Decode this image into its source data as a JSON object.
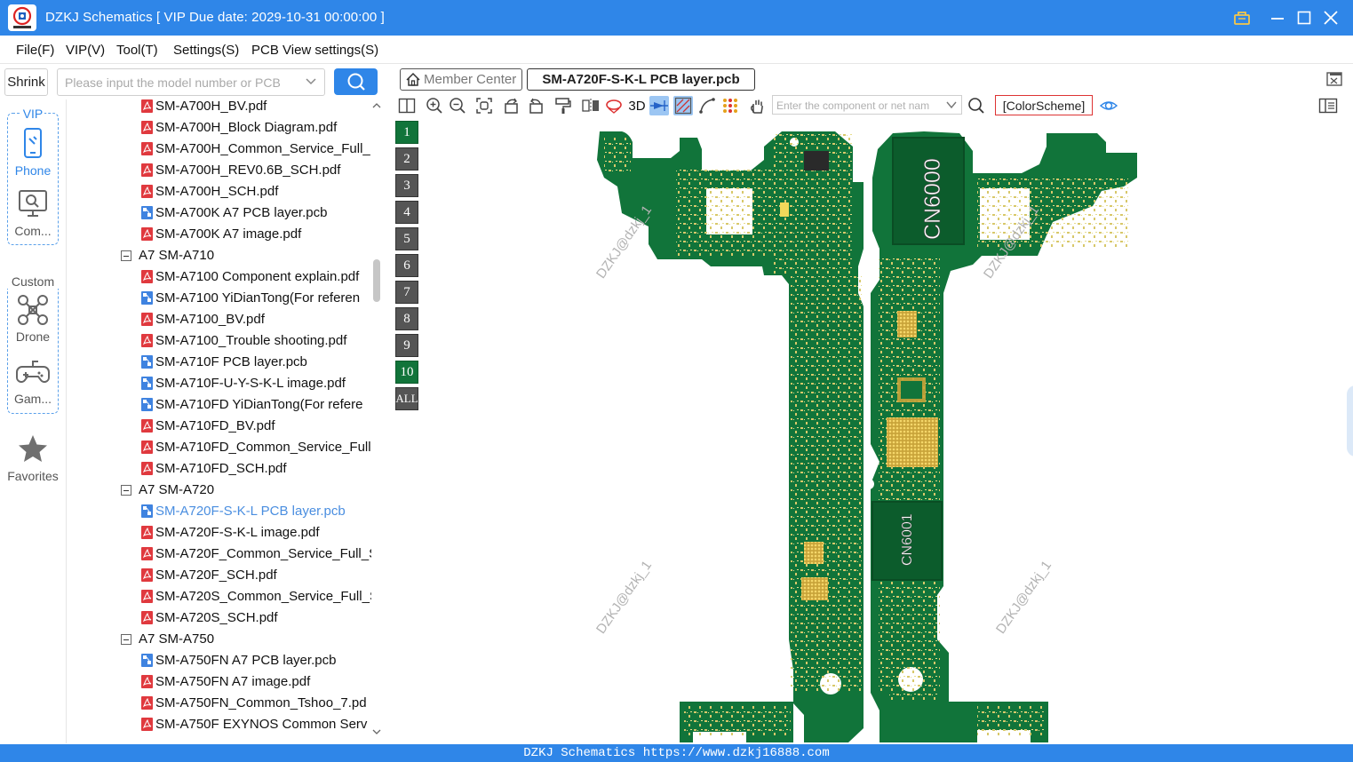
{
  "app": {
    "title": "DZKJ Schematics [ VIP Due date: 2029-10-31 00:00:00 ]",
    "accent": "#2f86e8"
  },
  "menu": [
    "File(F)",
    "VIP(V)",
    "Tool(T)",
    "Settings(S)",
    "PCB View settings(S)"
  ],
  "sidebar": {
    "shrink_label": "Shrink",
    "search_placeholder": "Please input the model number or PCB",
    "vip_label": "VIP",
    "custom_label": "Custom",
    "items": [
      {
        "label": "Phone",
        "icon": "phone-icon"
      },
      {
        "label": "Com...",
        "icon": "computer-icon"
      },
      {
        "label": "Drone",
        "icon": "drone-icon"
      },
      {
        "label": "Gam...",
        "icon": "gamepad-icon"
      },
      {
        "label": "Favorites",
        "icon": "star-icon"
      }
    ]
  },
  "tree": [
    {
      "type": "pdf",
      "label": "SM-A700H_BV.pdf"
    },
    {
      "type": "pdf",
      "label": "SM-A700H_Block Diagram.pdf"
    },
    {
      "type": "pdf",
      "label": "SM-A700H_Common_Service_Full_"
    },
    {
      "type": "pdf",
      "label": "SM-A700H_REV0.6B_SCH.pdf"
    },
    {
      "type": "pdf",
      "label": "SM-A700H_SCH.pdf"
    },
    {
      "type": "pcb",
      "label": "SM-A700K A7 PCB layer.pcb"
    },
    {
      "type": "pdf",
      "label": "SM-A700K A7 image.pdf"
    },
    {
      "type": "group",
      "label": "A7 SM-A710"
    },
    {
      "type": "pdf",
      "label": "SM-A7100 Component explain.pdf"
    },
    {
      "type": "pcb",
      "label": "SM-A7100 YiDianTong(For referen"
    },
    {
      "type": "pdf",
      "label": "SM-A7100_BV.pdf"
    },
    {
      "type": "pdf",
      "label": "SM-A7100_Trouble shooting.pdf"
    },
    {
      "type": "pcb",
      "label": "SM-A710F PCB layer.pcb"
    },
    {
      "type": "pcb",
      "label": "SM-A710F-U-Y-S-K-L image.pdf"
    },
    {
      "type": "pcb",
      "label": "SM-A710FD YiDianTong(For refere"
    },
    {
      "type": "pdf",
      "label": "SM-A710FD_BV.pdf"
    },
    {
      "type": "pdf",
      "label": "SM-A710FD_Common_Service_Full"
    },
    {
      "type": "pdf",
      "label": "SM-A710FD_SCH.pdf"
    },
    {
      "type": "group",
      "label": "A7 SM-A720"
    },
    {
      "type": "pcb",
      "label": "SM-A720F-S-K-L PCB layer.pcb",
      "selected": true
    },
    {
      "type": "pdf",
      "label": "SM-A720F-S-K-L image.pdf"
    },
    {
      "type": "pdf",
      "label": "SM-A720F_Common_Service_Full_S"
    },
    {
      "type": "pdf",
      "label": "SM-A720F_SCH.pdf"
    },
    {
      "type": "pdf",
      "label": "SM-A720S_Common_Service_Full_S"
    },
    {
      "type": "pdf",
      "label": "SM-A720S_SCH.pdf"
    },
    {
      "type": "group",
      "label": "A7 SM-A750"
    },
    {
      "type": "pcb",
      "label": "SM-A750FN A7 PCB layer.pcb"
    },
    {
      "type": "pdf",
      "label": "SM-A750FN A7 image.pdf"
    },
    {
      "type": "pdf",
      "label": "SM-A750FN_Common_Tshoo_7.pd"
    },
    {
      "type": "pdf",
      "label": "SM-A750F EXYNOS Common Serv"
    }
  ],
  "tabs": {
    "member_center": "Member Center",
    "active_file": "SM-A720F-S-K-L PCB layer.pcb"
  },
  "toolbar": {
    "three_d_label": "3D",
    "component_placeholder": "Enter the component or net nam",
    "color_scheme_label": "[ColorScheme]"
  },
  "layers": [
    "1",
    "2",
    "3",
    "4",
    "5",
    "6",
    "7",
    "8",
    "9",
    "10",
    "ALL"
  ],
  "active_layers": [
    "1",
    "10"
  ],
  "pcb": {
    "labels": [
      "CN6000",
      "CN6001"
    ],
    "watermark": "DZKJ@dzkj_1",
    "board_color": "#11743a"
  },
  "status": {
    "text": "DZKJ Schematics https://www.dzkj16888.com"
  }
}
